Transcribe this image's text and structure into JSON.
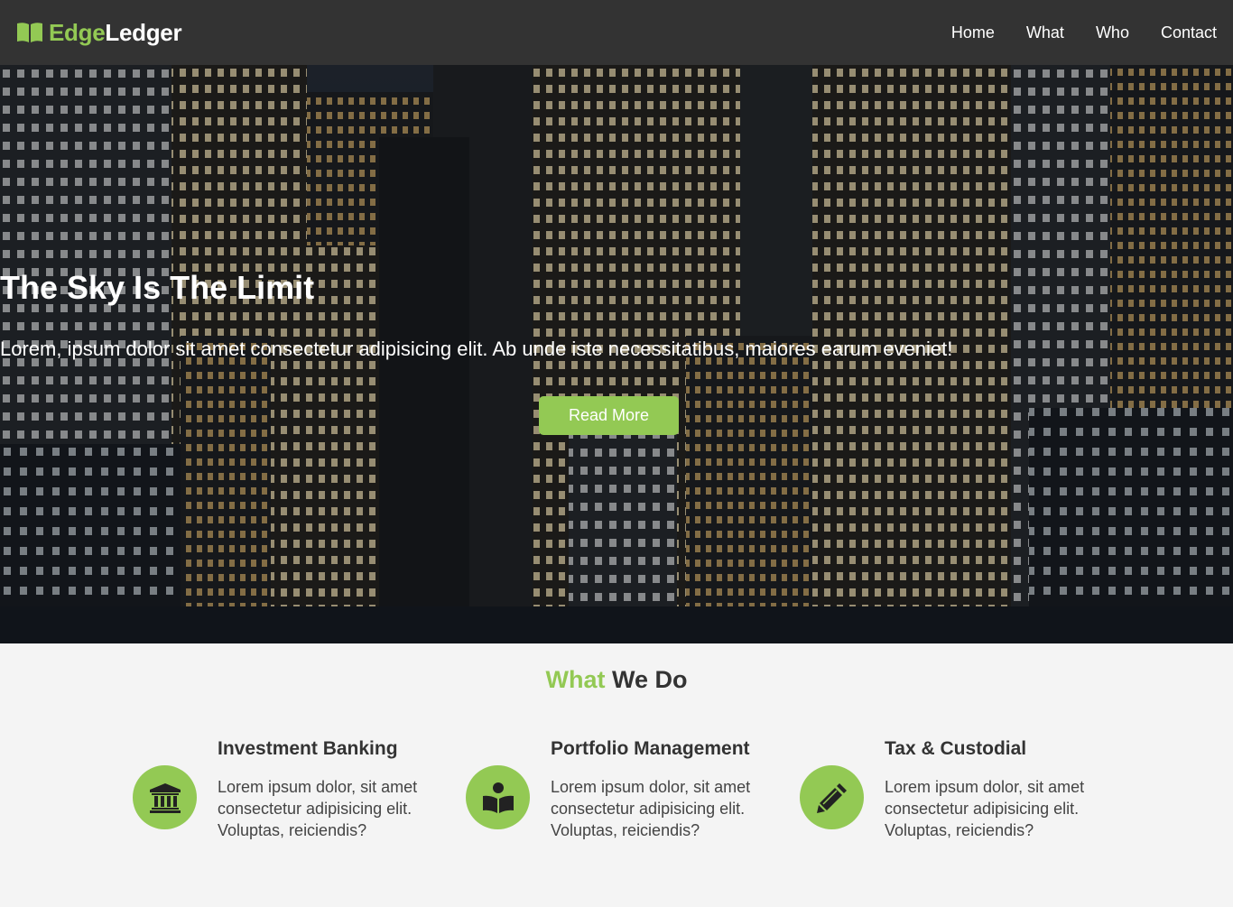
{
  "brand": {
    "accent": "Edge",
    "rest": "Ledger",
    "icon": "book-open-icon"
  },
  "nav": {
    "items": [
      "Home",
      "What",
      "Who",
      "Contact"
    ]
  },
  "hero": {
    "title": "The Sky Is The Limit",
    "text": "Lorem, ipsum dolor sit amet consectetur adipisicing elit. Ab unde iste necessitatibus, maiores earum eveniet!",
    "button": "Read More"
  },
  "what": {
    "title_accent": "What",
    "title_rest": " We Do",
    "items": [
      {
        "title": "Investment Banking",
        "text": "Lorem ipsum dolor, sit amet consectetur adipisicing elit. Voluptas, reiciendis?",
        "icon": "university-icon"
      },
      {
        "title": "Portfolio Management",
        "text": "Lorem ipsum dolor, sit amet consectetur adipisicing elit. Voluptas, reiciendis?",
        "icon": "book-reader-icon"
      },
      {
        "title": "Tax & Custodial",
        "text": "Lorem ipsum dolor, sit amet consectetur adipisicing elit. Voluptas, reiciendis?",
        "icon": "pencil-icon"
      }
    ]
  },
  "colors": {
    "accent": "#93c954",
    "navbar": "#333333",
    "section_bg": "#f4f4f4"
  }
}
